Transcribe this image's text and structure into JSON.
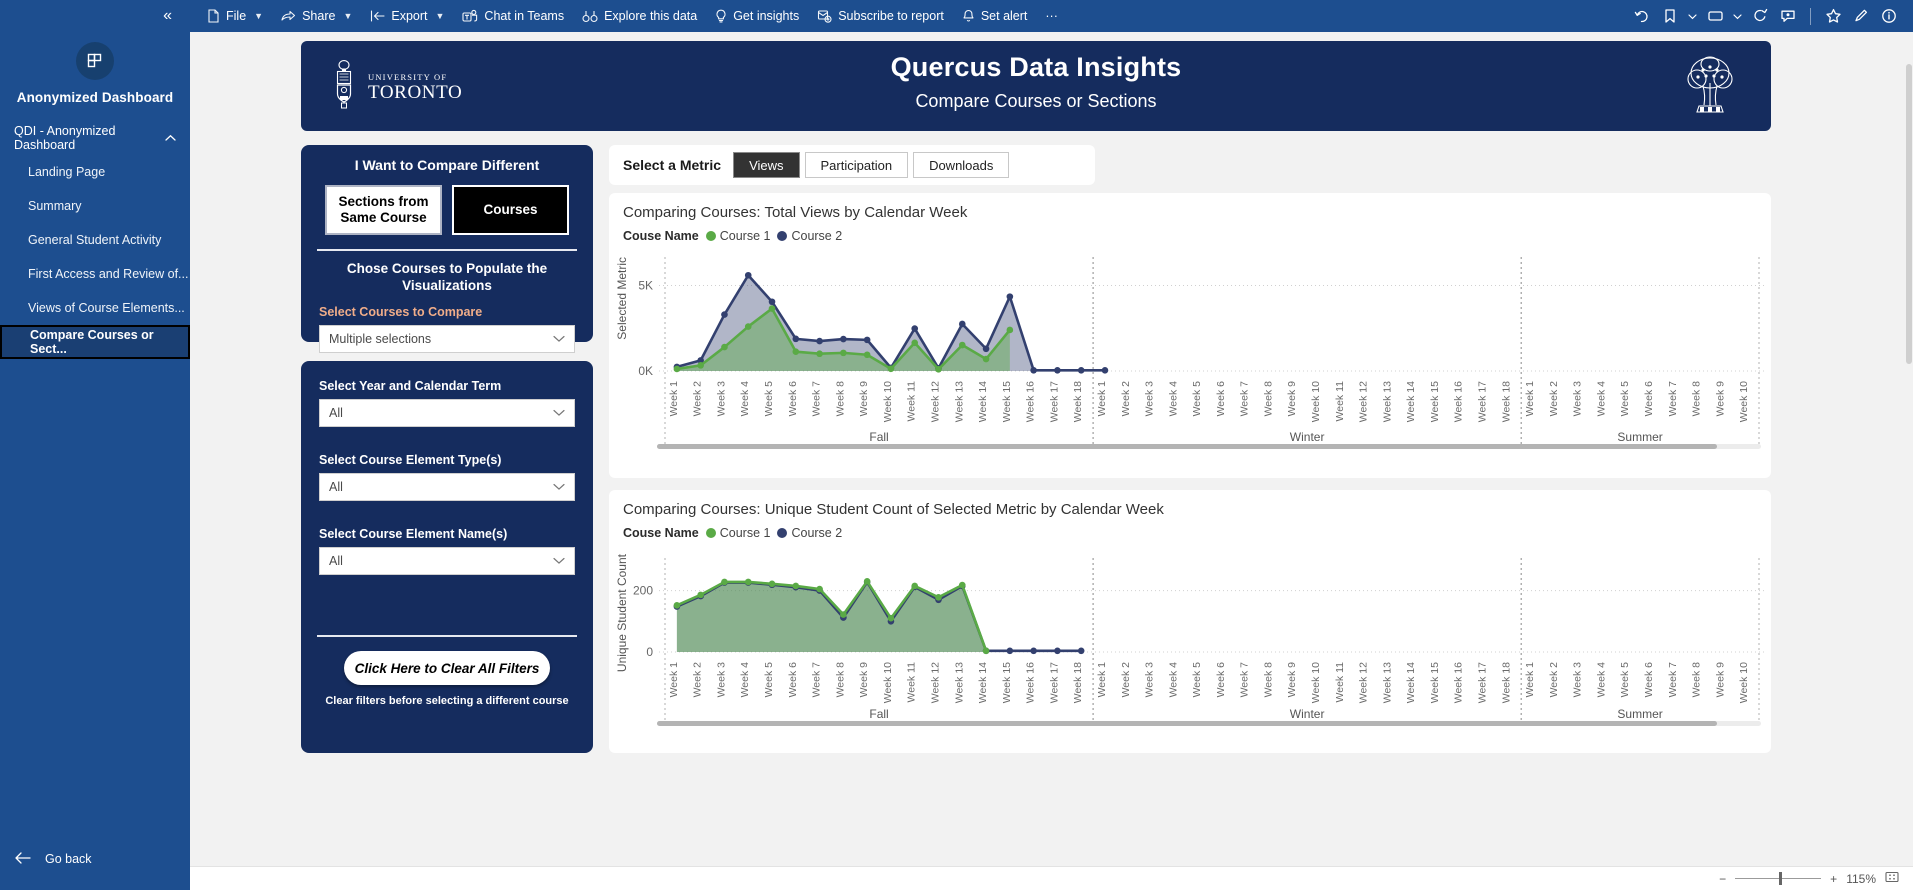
{
  "ribbon": {
    "collapse_icon": "double-chevron-left",
    "items": [
      {
        "label": "File",
        "icon": "file-icon",
        "chevron": true
      },
      {
        "label": "Share",
        "icon": "share-icon",
        "chevron": true
      },
      {
        "label": "Export",
        "icon": "export-icon",
        "chevron": true
      },
      {
        "label": "Chat in Teams",
        "icon": "teams-icon",
        "chevron": false
      },
      {
        "label": "Explore this data",
        "icon": "explore-icon",
        "chevron": false
      },
      {
        "label": "Get insights",
        "icon": "lightbulb-icon",
        "chevron": false
      },
      {
        "label": "Subscribe to report",
        "icon": "subscribe-icon",
        "chevron": false
      },
      {
        "label": "Set alert",
        "icon": "bell-icon",
        "chevron": false
      },
      {
        "label": "···",
        "icon": "more-icon",
        "chevron": false
      }
    ],
    "right_icons": [
      "reset-icon",
      "bookmark-icon",
      "bookmark-chevron-icon",
      "view-icon",
      "view-chevron-icon",
      "refresh-icon",
      "comment-icon",
      "favorite-star-icon",
      "edit-pencil-icon",
      "info-icon"
    ]
  },
  "sidebar": {
    "logo_icon": "powerbi-workspace-icon",
    "workspace": "Anonymized Dashboard",
    "group_label": "QDI - Anonymized Dashboard",
    "group_chevron": "chevron-up",
    "items": [
      {
        "label": "Landing Page",
        "selected": false
      },
      {
        "label": "Summary",
        "selected": false
      },
      {
        "label": "General Student Activity",
        "selected": false
      },
      {
        "label": "First Access and Review of...",
        "selected": false
      },
      {
        "label": "Views of Course Elements...",
        "selected": false
      },
      {
        "label": "Compare Courses or Sect...",
        "selected": true
      }
    ],
    "go_back": "Go back",
    "go_back_icon": "arrow-left-icon"
  },
  "banner": {
    "title": "Quercus Data Insights",
    "subtitle": "Compare Courses or Sections",
    "university_line1": "UNIVERSITY OF",
    "university_line2": "TORONTO",
    "left_logo_icon": "uoft-shield-icon",
    "right_logo_icon": "oak-tree-icon",
    "bg_color": "#152c5e"
  },
  "compare_card": {
    "heading": "I Want to Compare Different",
    "options": [
      {
        "label": "Sections from Same Course",
        "selected": false
      },
      {
        "label": "Courses",
        "selected": true
      }
    ],
    "subheading": "Chose Courses to Populate the Visualizations",
    "slicer_label": "Select Courses to Compare",
    "slicer_value": "Multiple selections",
    "slicer_label_color": "#f0ad89"
  },
  "filters_card": {
    "filters": [
      {
        "label": "Select Year and Calendar Term",
        "value": "All"
      },
      {
        "label": "Select Course Element Type(s)",
        "value": "All"
      },
      {
        "label": "Select Course Element Name(s)",
        "value": "All"
      }
    ],
    "clear_button": "Click Here to Clear All Filters",
    "clear_note": "Clear filters before selecting a different course"
  },
  "metric_bar": {
    "label": "Select a Metric",
    "tabs": [
      {
        "label": "Views",
        "selected": true
      },
      {
        "label": "Participation",
        "selected": false
      },
      {
        "label": "Downloads",
        "selected": false
      }
    ]
  },
  "legend": {
    "title": "Couse Name",
    "series": [
      {
        "name": "Course 1",
        "color": "#5aaa46"
      },
      {
        "name": "Course 2",
        "color": "#33406f"
      }
    ]
  },
  "zoom_control": {
    "minus": "−",
    "plus": "+",
    "level": "115%",
    "fit_icon": "fit-to-page-icon"
  },
  "chart_data": [
    {
      "type": "area",
      "title": "Comparing Courses: Total Views by Calendar Week",
      "xlabel": "",
      "ylabel": "Selected Metric",
      "ylim": [
        0,
        6200
      ],
      "yticks": [
        0,
        5000
      ],
      "ytick_labels": [
        "0K",
        "5K"
      ],
      "grid": true,
      "legend_position": "top-left",
      "groups": [
        {
          "name": "Fall",
          "weeks": 18
        },
        {
          "name": "Winter",
          "weeks": 18
        },
        {
          "name": "Summer",
          "weeks": 10
        }
      ],
      "categories": [
        "Week 1",
        "Week 2",
        "Week 3",
        "Week 4",
        "Week 5",
        "Week 6",
        "Week 7",
        "Week 8",
        "Week 9",
        "Week 10",
        "Week 11",
        "Week 12",
        "Week 13",
        "Week 14",
        "Week 15",
        "Week 16",
        "Week 17",
        "Week 18",
        "Week 1",
        "Week 2",
        "Week 3",
        "Week 4",
        "Week 5",
        "Week 6",
        "Week 7",
        "Week 8",
        "Week 9",
        "Week 10",
        "Week 11",
        "Week 12",
        "Week 13",
        "Week 14",
        "Week 15",
        "Week 16",
        "Week 17",
        "Week 18",
        "Week 1",
        "Week 2",
        "Week 3",
        "Week 4",
        "Week 5",
        "Week 6",
        "Week 7",
        "Week 8",
        "Week 9",
        "Week 10"
      ],
      "series": [
        {
          "name": "Course 1",
          "color": "#5aaa46",
          "values": [
            120,
            330,
            1400,
            2600,
            3650,
            1130,
            1010,
            1060,
            950,
            130,
            1650,
            100,
            1520,
            700,
            2400,
            null,
            null,
            null,
            null,
            null,
            null,
            null,
            null,
            null,
            null,
            null,
            null,
            null,
            null,
            null,
            null,
            null,
            null,
            null,
            null,
            null,
            null,
            null,
            null,
            null,
            null,
            null,
            null,
            null,
            null,
            null
          ]
        },
        {
          "name": "Course 2",
          "color": "#33406f",
          "values": [
            240,
            620,
            3300,
            5600,
            4050,
            1880,
            1750,
            1870,
            1820,
            180,
            2480,
            160,
            2750,
            1300,
            4350,
            40,
            40,
            40,
            40,
            null,
            null,
            null,
            null,
            null,
            null,
            null,
            null,
            null,
            null,
            null,
            null,
            null,
            null,
            null,
            null,
            null,
            null,
            null,
            null,
            null,
            null,
            null,
            null,
            null,
            null,
            null,
            null
          ]
        }
      ]
    },
    {
      "type": "area",
      "title": "Comparing Courses: Unique Student Count of Selected Metric by Calendar Week",
      "xlabel": "",
      "ylabel": "Unique Student Count",
      "ylim": [
        0,
        280
      ],
      "yticks": [
        0,
        200
      ],
      "ytick_labels": [
        "0",
        "200"
      ],
      "grid": true,
      "legend_position": "top-left",
      "groups": [
        {
          "name": "Fall",
          "weeks": 18
        },
        {
          "name": "Winter",
          "weeks": 18
        },
        {
          "name": "Summer",
          "weeks": 10
        }
      ],
      "categories": [
        "Week 1",
        "Week 2",
        "Week 3",
        "Week 4",
        "Week 5",
        "Week 6",
        "Week 7",
        "Week 8",
        "Week 9",
        "Week 10",
        "Week 11",
        "Week 12",
        "Week 13",
        "Week 14",
        "Week 15",
        "Week 16",
        "Week 17",
        "Week 18",
        "Week 1",
        "Week 2",
        "Week 3",
        "Week 4",
        "Week 5",
        "Week 6",
        "Week 7",
        "Week 8",
        "Week 9",
        "Week 10",
        "Week 11",
        "Week 12",
        "Week 13",
        "Week 14",
        "Week 15",
        "Week 16",
        "Week 17",
        "Week 18",
        "Week 1",
        "Week 2",
        "Week 3",
        "Week 4",
        "Week 5",
        "Week 6",
        "Week 7",
        "Week 8",
        "Week 9",
        "Week 10"
      ],
      "series": [
        {
          "name": "Course 1",
          "color": "#5aaa46",
          "values": [
            152,
            186,
            228,
            228,
            222,
            215,
            205,
            122,
            230,
            110,
            215,
            178,
            218,
            4,
            null,
            null,
            null,
            null,
            null,
            null,
            null,
            null,
            null,
            null,
            null,
            null,
            null,
            null,
            null,
            null,
            null,
            null,
            null,
            null,
            null,
            null,
            null,
            null,
            null,
            null,
            null,
            null,
            null,
            null,
            null,
            null
          ]
        },
        {
          "name": "Course 2",
          "color": "#33406f",
          "values": [
            148,
            182,
            226,
            226,
            219,
            211,
            200,
            112,
            228,
            100,
            212,
            170,
            215,
            4,
            4,
            4,
            4,
            4,
            null,
            null,
            null,
            null,
            null,
            null,
            null,
            null,
            null,
            null,
            null,
            null,
            null,
            null,
            null,
            null,
            null,
            null,
            null,
            null,
            null,
            null,
            null,
            null,
            null,
            null,
            null,
            null
          ]
        }
      ]
    }
  ]
}
